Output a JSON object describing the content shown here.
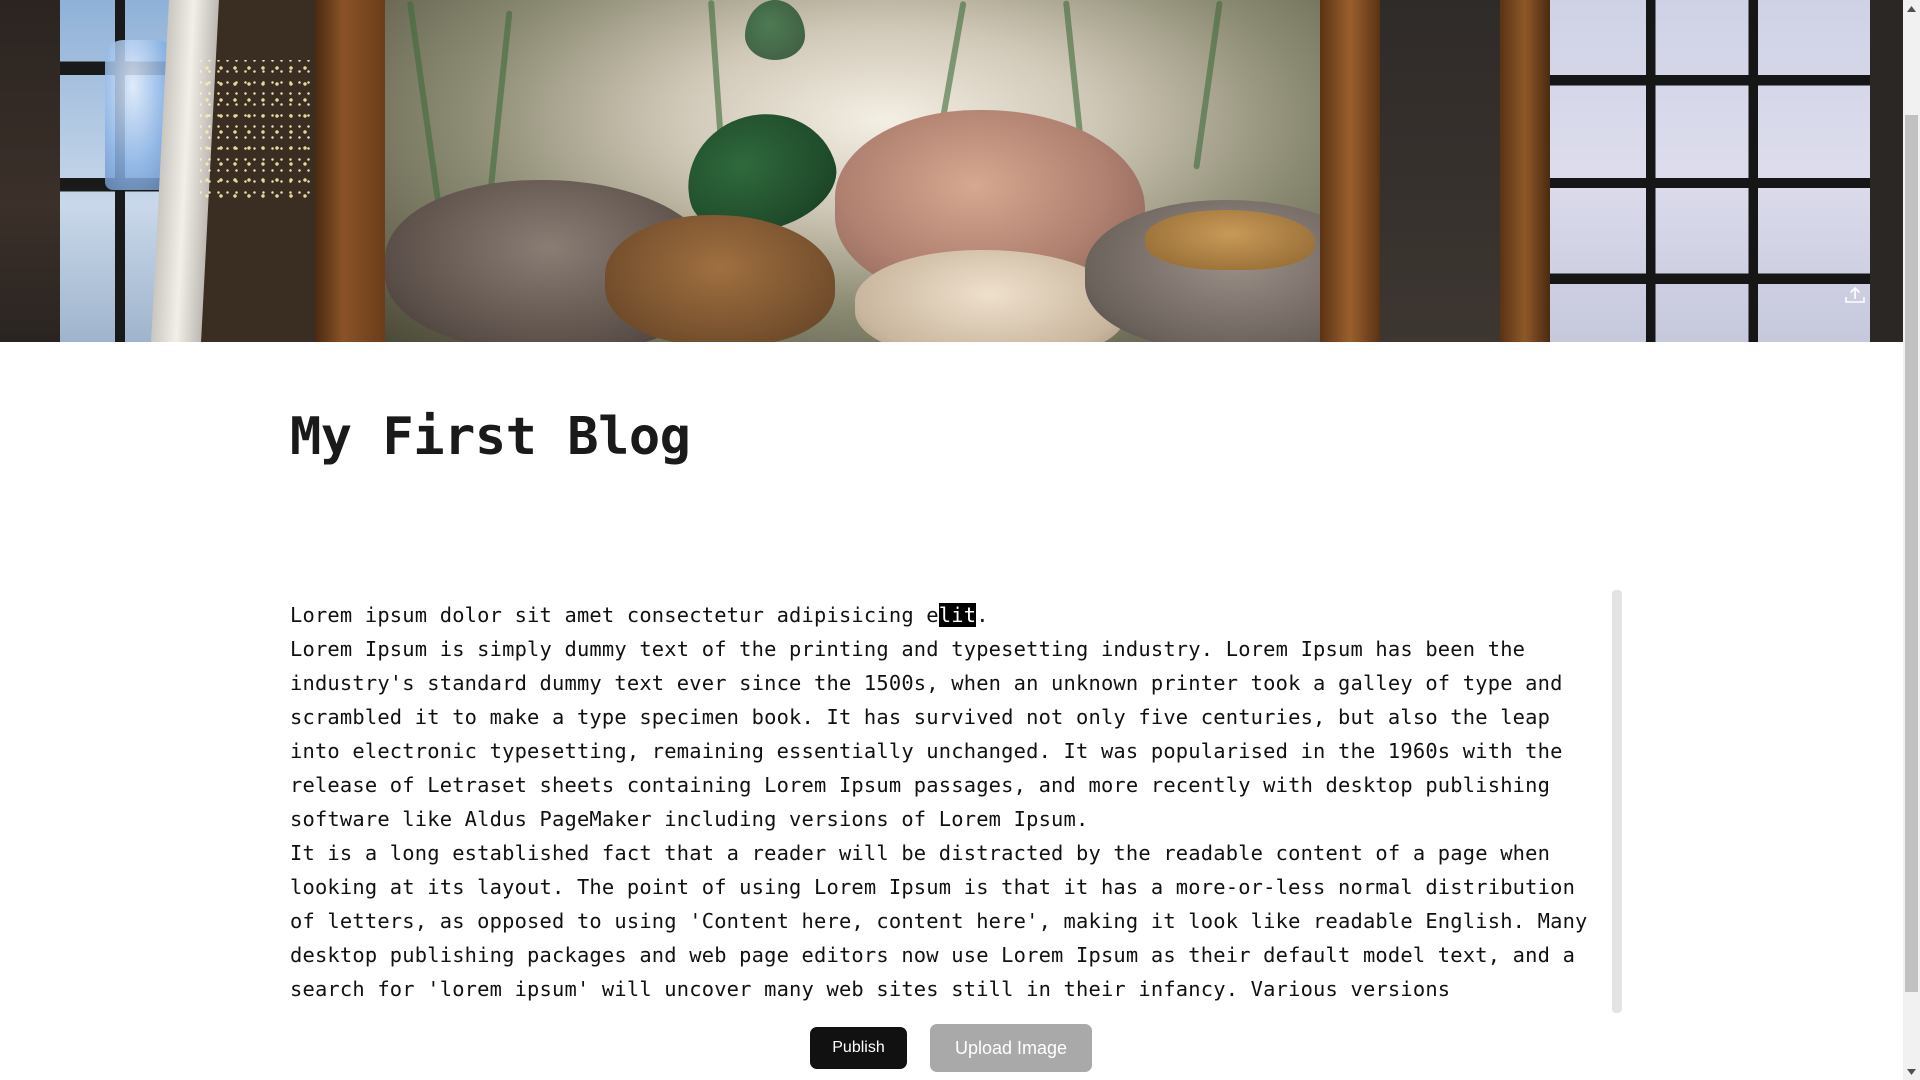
{
  "hero": {
    "image_alt": "Room with fluffy pillows and plants behind wooden frames",
    "upload_icon": "upload-icon"
  },
  "post": {
    "title": "My First Blog",
    "body": {
      "line1_before_selection": "Lorem ipsum dolor sit amet consectetur adipisicing e",
      "line1_selected": "lit",
      "line1_after_selection": ".",
      "paragraph2": "Lorem Ipsum is simply dummy text of the printing and typesetting industry. Lorem Ipsum has been the industry's standard dummy text ever since the 1500s, when an unknown printer took a galley of type and scrambled it to make a type specimen book. It has survived not only five centuries, but also the leap into electronic typesetting, remaining essentially unchanged. It was popularised in the 1960s with the release of Letraset sheets containing Lorem Ipsum passages, and more recently with desktop publishing software like Aldus PageMaker including versions of Lorem Ipsum.",
      "paragraph3": "It is a long established fact that a reader will be distracted by the readable content of a page when looking at its layout. The point of using Lorem Ipsum is that it has a more-or-less normal distribution of letters, as opposed to using 'Content here, content here', making it look like readable English. Many desktop publishing packages and web page editors now use Lorem Ipsum as their default model text, and a search for 'lorem ipsum' will uncover many web sites still in their infancy. Various versions"
    }
  },
  "actions": {
    "publish_label": "Publish",
    "upload_image_label": "Upload Image"
  },
  "colors": {
    "publish_bg": "#111111",
    "upload_bg": "#a9a9a9",
    "selection_bg": "#000000"
  }
}
